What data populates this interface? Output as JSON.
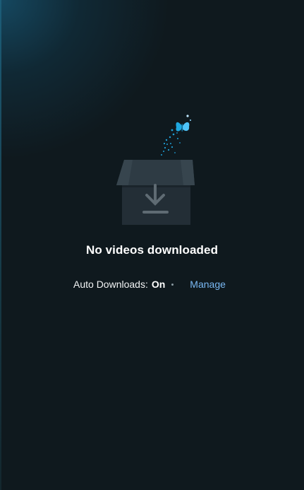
{
  "empty_state": {
    "illustration_icon": "open-box-download-icon",
    "sparkle_icon": "butterfly-icon",
    "title": "No videos downloaded"
  },
  "auto_downloads": {
    "label": "Auto Downloads:",
    "state": "On",
    "manage_label": "Manage"
  },
  "colors": {
    "background": "#0f191e",
    "accent_blue": "#1fa8e0",
    "link": "#79b8f3"
  }
}
